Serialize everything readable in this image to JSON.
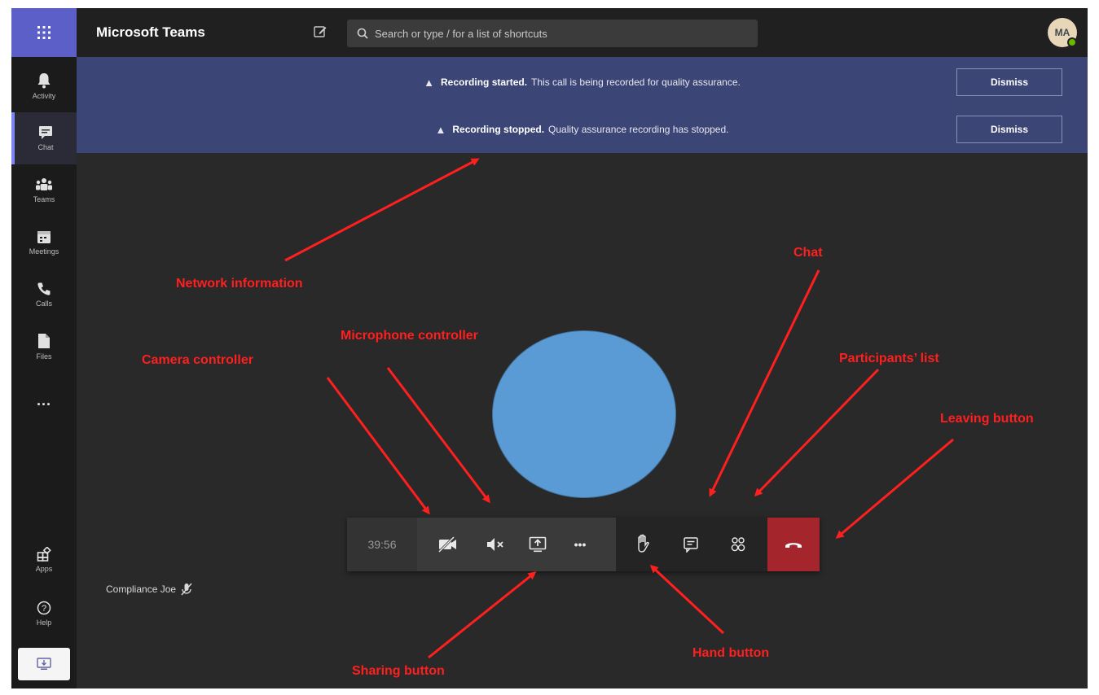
{
  "app": {
    "title": "Microsoft Teams"
  },
  "search": {
    "placeholder": "Search or type / for a list of shortcuts"
  },
  "user": {
    "initials": "MA",
    "presence_color": "#6bb700"
  },
  "rail": {
    "items": [
      {
        "label": "Activity",
        "icon": "bell-icon"
      },
      {
        "label": "Chat",
        "icon": "chat-icon"
      },
      {
        "label": "Teams",
        "icon": "teams-icon"
      },
      {
        "label": "Meetings",
        "icon": "calendar-icon"
      },
      {
        "label": "Calls",
        "icon": "phone-icon"
      },
      {
        "label": "Files",
        "icon": "file-icon"
      },
      {
        "label": "Apps",
        "icon": "apps-icon"
      },
      {
        "label": "Help",
        "icon": "help-icon"
      }
    ],
    "more_label": "...",
    "active": "Chat"
  },
  "banners": [
    {
      "title": "Recording started.",
      "message": "This call is being recorded for quality assurance.",
      "button": "Dismiss"
    },
    {
      "title": "Recording stopped.",
      "message": "Quality assurance recording has stopped.",
      "button": "Dismiss"
    }
  ],
  "call": {
    "timer": "39:56",
    "controls": [
      "camera-off-icon",
      "mute-icon",
      "share-screen-icon",
      "more-icon",
      "raise-hand-icon",
      "chat-icon",
      "participants-icon",
      "hang-up-icon"
    ],
    "more_label": "•••",
    "leave_color": "#a4262c"
  },
  "participant": {
    "name": "Compliance Joe"
  },
  "annotations": {
    "network": "Network information",
    "chat": "Chat",
    "microphone": "Microphone controller",
    "camera": "Camera controller",
    "participants": "Participants’ list",
    "leaving": "Leaving button",
    "hand": "Hand button",
    "sharing": "Sharing button"
  },
  "colors": {
    "accent": "#5b5fc7",
    "banner": "#3b4576",
    "annotation": "#ff1f1f",
    "shape": "#5b9bd5"
  }
}
